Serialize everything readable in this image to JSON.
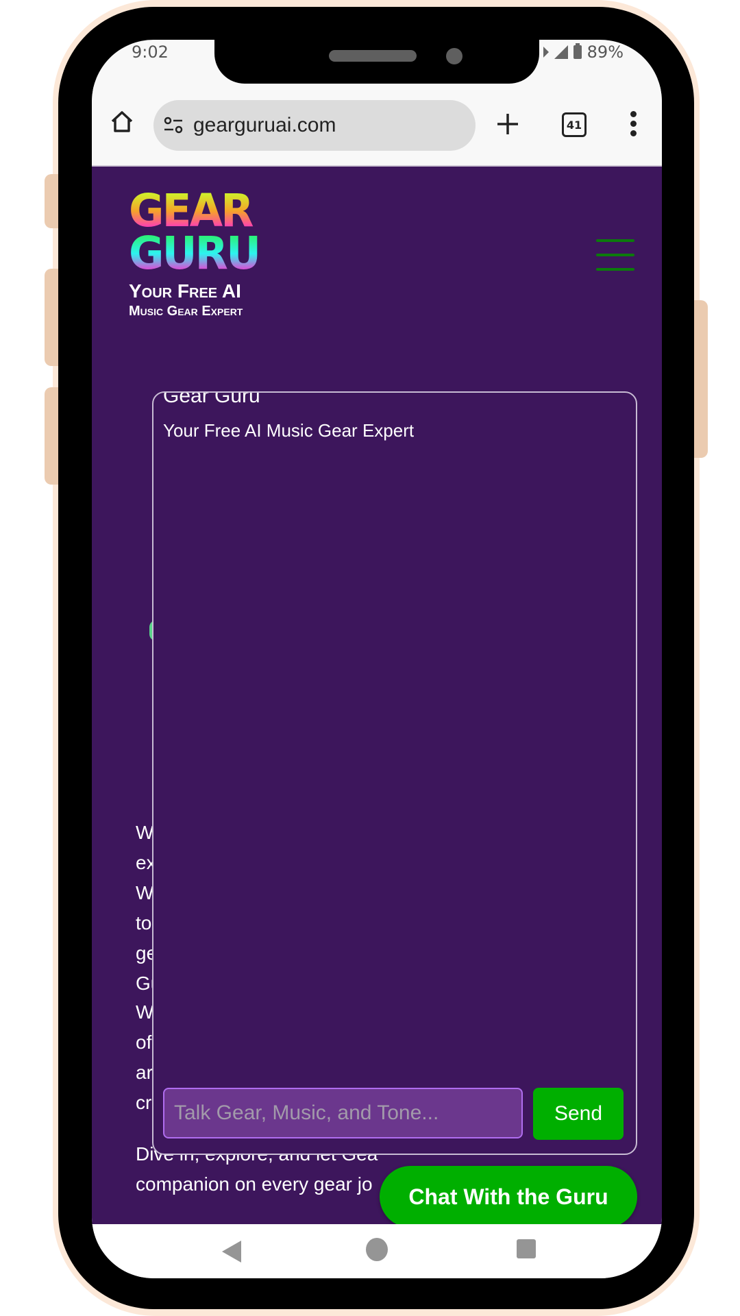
{
  "status_bar": {
    "time": "9:02",
    "battery": "89%"
  },
  "browser": {
    "url": "gearguruai.com",
    "tab_count": "41",
    "icons": {
      "home": "home-icon",
      "site_settings": "tune-icon",
      "new_tab": "plus-icon",
      "tabs": "tab-switcher-icon",
      "menu": "more-vert-icon"
    }
  },
  "site": {
    "logo": {
      "line1": "GEAR",
      "line2": "GURU",
      "tagline1": "Your Free AI",
      "tagline2": "Music Gear Expert"
    },
    "menu_icon": "hamburger-icon",
    "paragraphs": [
      "W ex W to ge Gu",
      "W of ar cr",
      "Dive in, explore, and let Gea companion on every gear jo"
    ]
  },
  "chat_panel": {
    "title": "Gear Guru",
    "subtitle": "Your Free AI Music Gear Expert",
    "input_placeholder": "Talk Gear, Music, and Tone...",
    "input_value": "",
    "send_label": "Send"
  },
  "chat_fab": {
    "label": "Chat With the Guru"
  },
  "colors": {
    "page_bg": "#3d165c",
    "accent_green": "#00af00",
    "input_bg": "#6b378d",
    "input_border": "#b06df0",
    "frame": "#fce8d8"
  }
}
